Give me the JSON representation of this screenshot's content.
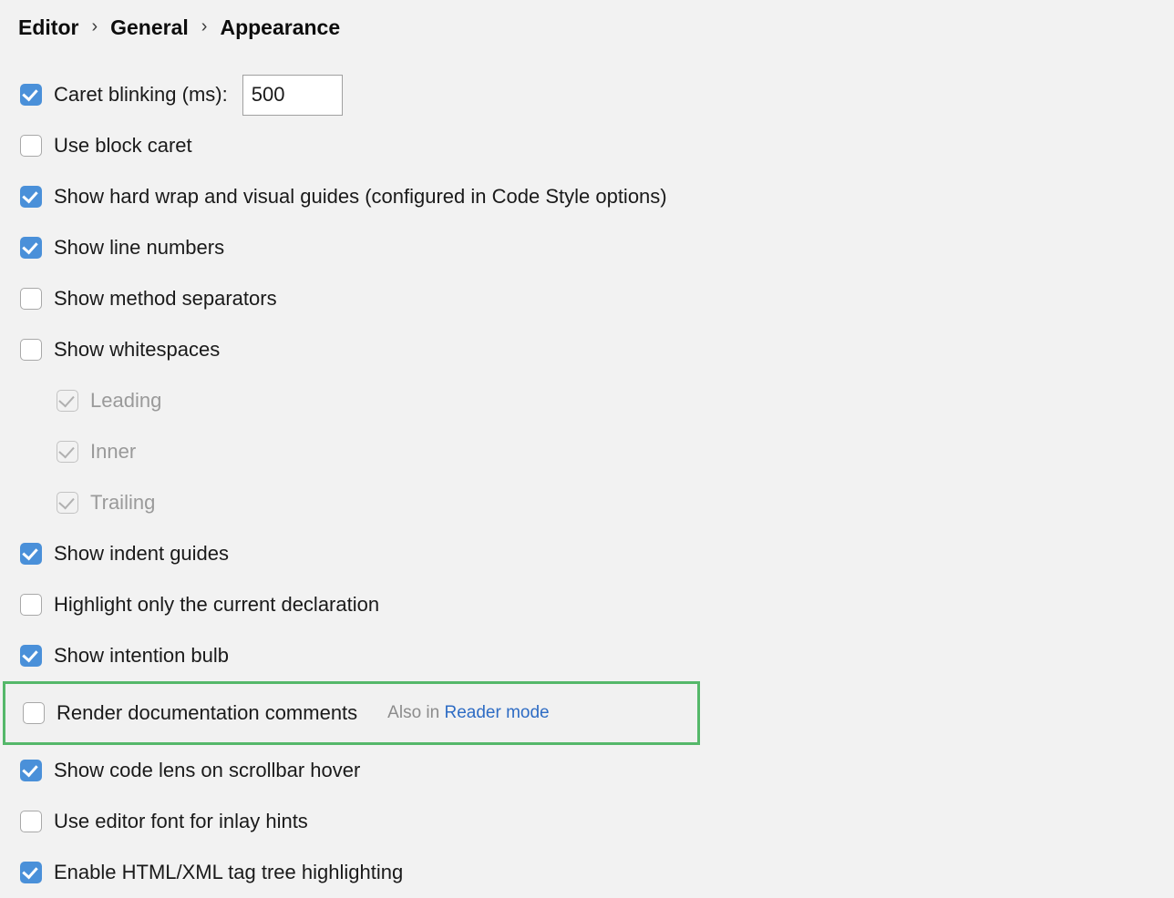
{
  "breadcrumb": {
    "separator": "›",
    "items": [
      {
        "label": "Editor"
      },
      {
        "label": "General"
      },
      {
        "label": "Appearance"
      }
    ]
  },
  "options": [
    {
      "name": "caret-blinking",
      "label": "Caret blinking (ms):",
      "state": "checked",
      "indent": false,
      "highlighted": false,
      "field": {
        "name": "caret-blinking-input",
        "value": "500"
      }
    },
    {
      "name": "use-block-caret",
      "label": "Use block caret",
      "state": "unchecked",
      "indent": false,
      "highlighted": false
    },
    {
      "name": "show-hard-wrap-and-visual-guides",
      "label": "Show hard wrap and visual guides (configured in Code Style options)",
      "state": "checked",
      "indent": false,
      "highlighted": false
    },
    {
      "name": "show-line-numbers",
      "label": "Show line numbers",
      "state": "checked",
      "indent": false,
      "highlighted": false
    },
    {
      "name": "show-method-separators",
      "label": "Show method separators",
      "state": "unchecked",
      "indent": false,
      "highlighted": false
    },
    {
      "name": "show-whitespaces",
      "label": "Show whitespaces",
      "state": "unchecked",
      "indent": false,
      "highlighted": false
    },
    {
      "name": "whitespaces-leading",
      "label": "Leading",
      "state": "disabled-checked",
      "indent": true,
      "highlighted": false
    },
    {
      "name": "whitespaces-inner",
      "label": "Inner",
      "state": "disabled-checked",
      "indent": true,
      "highlighted": false
    },
    {
      "name": "whitespaces-trailing",
      "label": "Trailing",
      "state": "disabled-checked",
      "indent": true,
      "highlighted": false
    },
    {
      "name": "show-indent-guides",
      "label": "Show indent guides",
      "state": "checked",
      "indent": false,
      "highlighted": false
    },
    {
      "name": "highlight-only-the-current-declaration",
      "label": "Highlight only the current declaration",
      "state": "unchecked",
      "indent": false,
      "highlighted": false
    },
    {
      "name": "show-intention-bulb",
      "label": "Show intention bulb",
      "state": "checked",
      "indent": false,
      "highlighted": false
    },
    {
      "name": "render-documentation-comments",
      "label": "Render documentation comments",
      "state": "unchecked",
      "indent": false,
      "highlighted": true,
      "hint": {
        "prefix": "Also in ",
        "link": "Reader mode"
      }
    },
    {
      "name": "show-code-lens-on-scrollbar-hover",
      "label": "Show code lens on scrollbar hover",
      "state": "checked",
      "indent": false,
      "highlighted": false
    },
    {
      "name": "use-editor-font-for-inlay-hints",
      "label": "Use editor font for inlay hints",
      "state": "unchecked",
      "indent": false,
      "highlighted": false
    },
    {
      "name": "enable-html-xml-tag-tree-highlighting",
      "label": "Enable HTML/XML tag tree highlighting",
      "state": "checked",
      "indent": false,
      "highlighted": false
    }
  ],
  "colors": {
    "background": "#f2f2f2",
    "checkbox_checked": "#4a90d9",
    "checkbox_border": "#a8a8a8",
    "highlight_border": "#55b86a",
    "link": "#2e6cc4",
    "hint_text": "#8c8c8c",
    "disabled_text": "#9a9a9a"
  }
}
